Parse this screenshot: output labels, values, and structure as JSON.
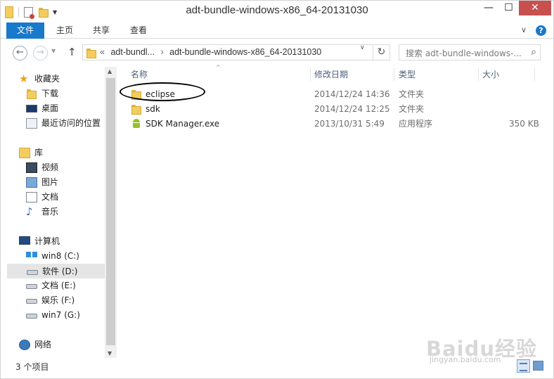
{
  "window": {
    "title": "adt-bundle-windows-x86_64-20131030"
  },
  "title_buttons": {
    "minimize": "—",
    "maximize": "☐",
    "close": "✕"
  },
  "ribbon": {
    "tabs": [
      "文件",
      "主页",
      "共享",
      "查看"
    ],
    "expand_icon": "chevron-down",
    "help": "?"
  },
  "address": {
    "overflow": "«",
    "segments": [
      "adt-bundl...",
      "adt-bundle-windows-x86_64-20131030"
    ],
    "separator": "›"
  },
  "search": {
    "placeholder": "搜索 adt-bundle-windows-..."
  },
  "nav": {
    "favorites": {
      "label": "收藏夹",
      "items": [
        "下载",
        "桌面",
        "最近访问的位置"
      ]
    },
    "libraries": {
      "label": "库",
      "items": [
        "视频",
        "图片",
        "文档",
        "音乐"
      ]
    },
    "computer": {
      "label": "计算机",
      "items": [
        "win8 (C:)",
        "软件 (D:)",
        "文档 (E:)",
        "娱乐 (F:)",
        "win7 (G:)"
      ],
      "selected": "软件 (D:)"
    },
    "network": {
      "label": "网络"
    }
  },
  "columns": {
    "name": "名称",
    "date": "修改日期",
    "type": "类型",
    "size": "大小"
  },
  "files": [
    {
      "name": "eclipse",
      "date": "2014/12/24 14:36",
      "type": "文件夹",
      "size": "",
      "icon": "folder-icon",
      "circled": true
    },
    {
      "name": "sdk",
      "date": "2014/12/24 12:25",
      "type": "文件夹",
      "size": "",
      "icon": "folder-icon"
    },
    {
      "name": "SDK Manager.exe",
      "date": "2013/10/31 5:49",
      "type": "应用程序",
      "size": "350 KB",
      "icon": "android-icon"
    }
  ],
  "status": {
    "item_count": "3 个项目"
  },
  "watermark": {
    "brand": "Baidu经验",
    "url": "jingyan.baidu.com"
  },
  "colors": {
    "accent": "#1979ca",
    "close": "#c7504f",
    "header_text": "#4c607a"
  }
}
